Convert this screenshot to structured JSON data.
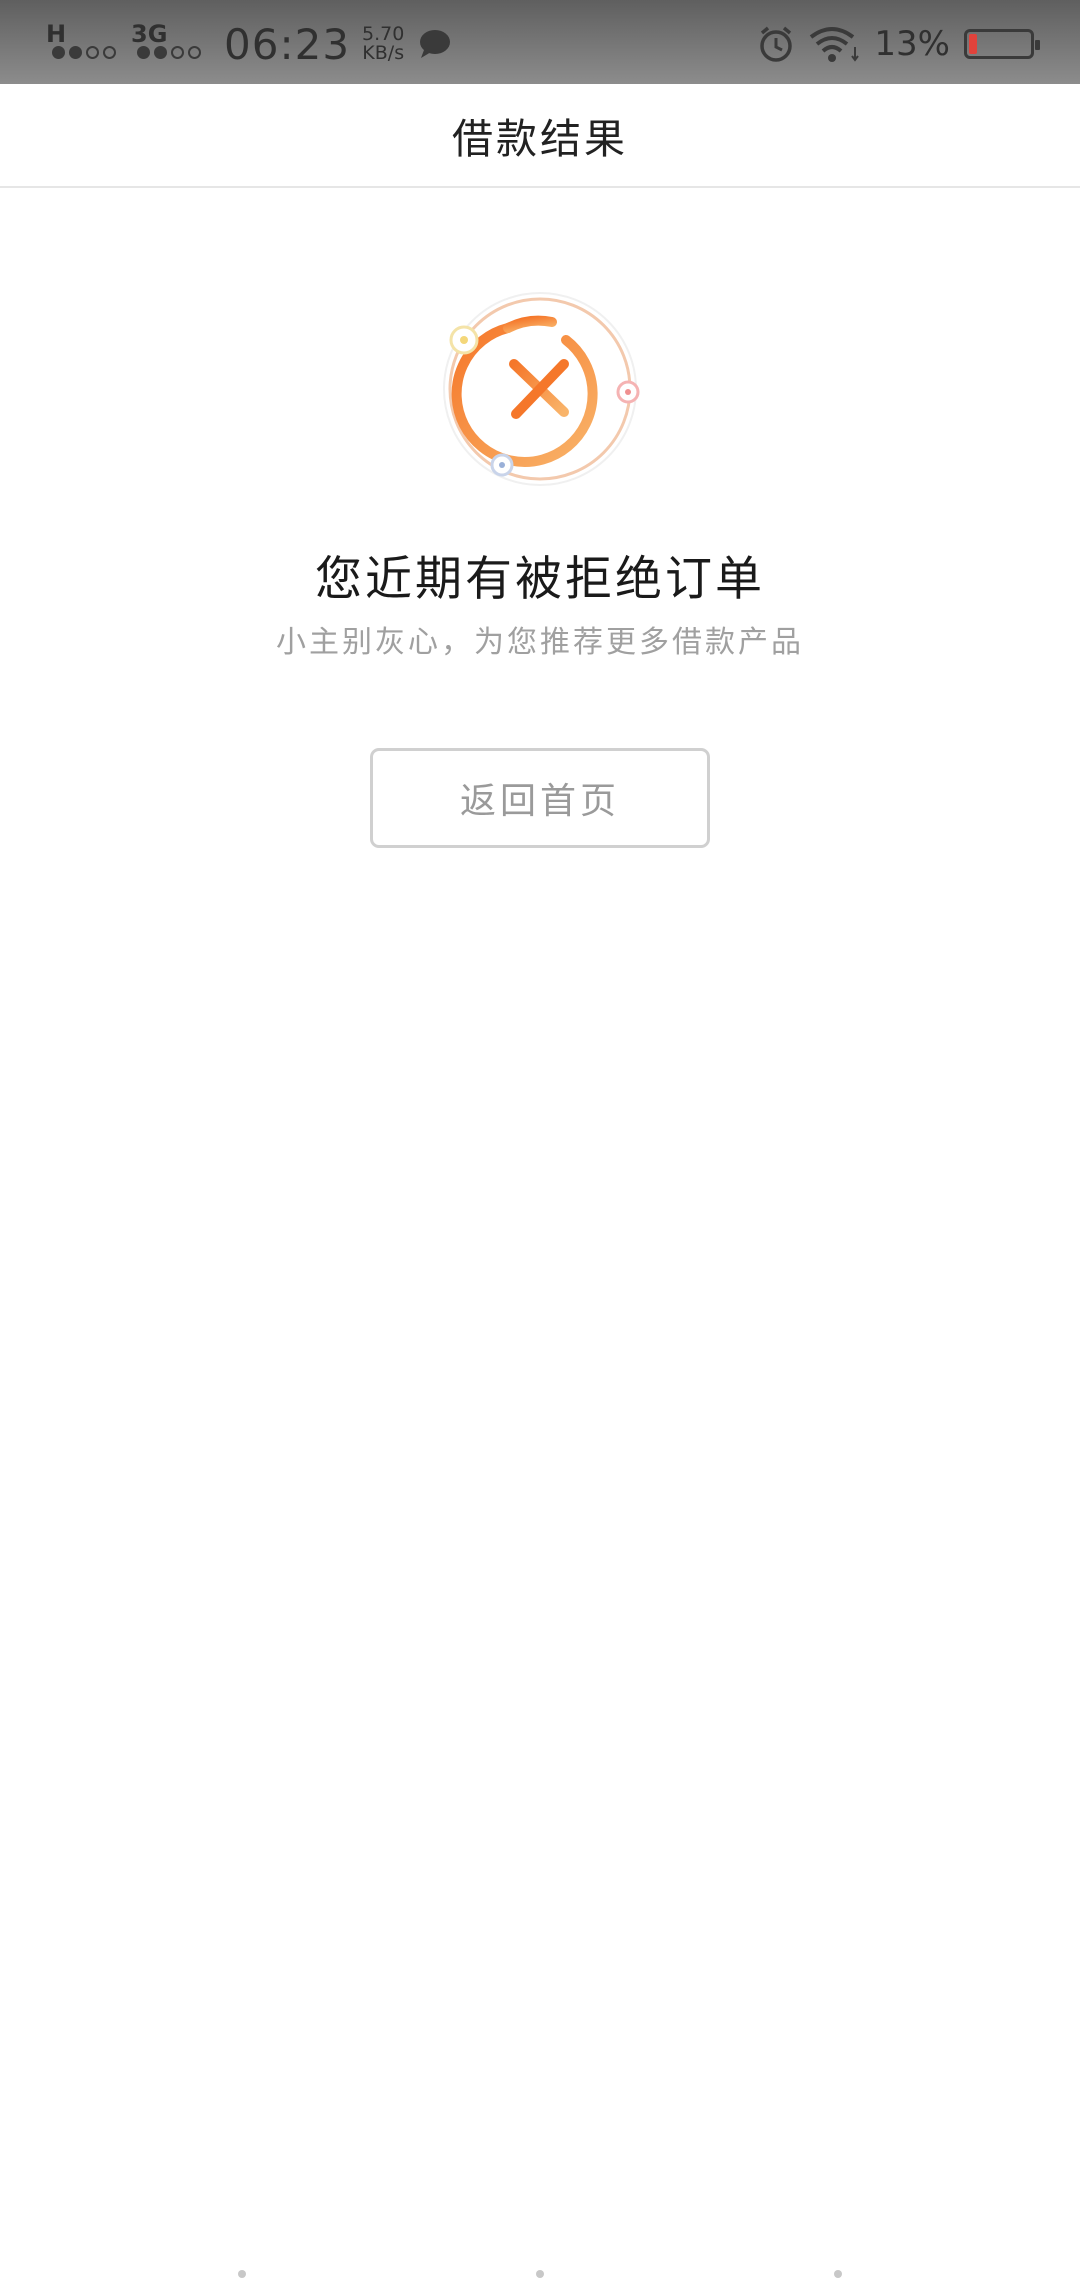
{
  "status_bar": {
    "signal1_label": "H",
    "signal2_label": "3G",
    "time": "06:23",
    "speed_value": "5.70",
    "speed_unit": "KB/s",
    "battery_percent": "13%",
    "battery_level": 0.13,
    "icons": [
      "message-icon",
      "alarm-icon",
      "wifi-icon",
      "battery-icon"
    ]
  },
  "header": {
    "title": "借款结果"
  },
  "result": {
    "icon": "rejected-x-icon",
    "title": "您近期有被拒绝订单",
    "subtitle": "小主别灰心，为您推荐更多借款产品"
  },
  "actions": {
    "home_label": "返回首页"
  },
  "colors": {
    "accent_orange": "#f5772a",
    "accent_light": "#f9b46a",
    "button_border": "#d0d0d0"
  }
}
